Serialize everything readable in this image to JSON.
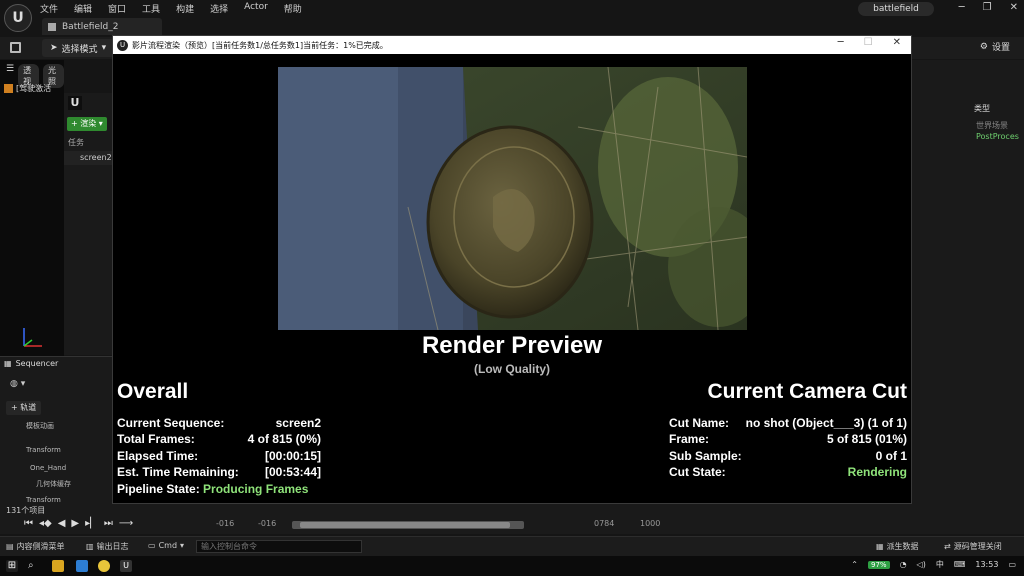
{
  "ue": {
    "menu": [
      "文件",
      "编辑",
      "窗口",
      "工具",
      "构建",
      "选择",
      "Actor",
      "帮助"
    ],
    "level_tab": "Battlefield_2",
    "project_name": "battlefield",
    "mode_label": "选择模式",
    "settings_label": "设置"
  },
  "viewport": {
    "perspective": "透视",
    "lit": "光照",
    "pilot_text": "[驾驶激活"
  },
  "mrq": {
    "add_label": "渲染",
    "tasks_header": "任务",
    "task_name": "screen2"
  },
  "sequencer": {
    "tab_label": "Sequencer",
    "track_label": "轨道",
    "rows": [
      "模板动画",
      "Transform",
      "One_Hand",
      "几何体缓存",
      "Transform"
    ]
  },
  "outliner": {
    "type_header": "类型",
    "rows": [
      "世界场景",
      "PostProces"
    ]
  },
  "dialog": {
    "title": "影片流程渲染（预览）[当前任务数1/总任务数1]当前任务：1%已完成。",
    "preview_title": "Render Preview",
    "preview_sub": "(Low Quality)",
    "overall_title": "Overall",
    "cut_title": "Current Camera Cut",
    "overall": [
      {
        "k": "Current Sequence:",
        "v": "screen2"
      },
      {
        "k": "Total Frames:",
        "v": "4 of 815 (0%)"
      },
      {
        "k": "Elapsed Time:",
        "v": "[00:00:15]"
      },
      {
        "k": "Est. Time Remaining:",
        "v": "[00:53:44]"
      }
    ],
    "pipeline_key": "Pipeline State:",
    "pipeline_val": "Producing Frames",
    "cut": [
      {
        "k": "Cut Name:",
        "v": "no shot (Object___3) (1 of 1)"
      },
      {
        "k": "Frame:",
        "v": "5 of 815 (01%)"
      },
      {
        "k": "Sub Sample:",
        "v": "0 of 1"
      }
    ],
    "cut_state_key": "Cut State:",
    "cut_state_val": "Rendering"
  },
  "timeline": {
    "items_count": "131个项目",
    "start_a": "-016",
    "start_b": "-016",
    "end_a": "0784",
    "end_b": "1000",
    "playhead_fraction": 0.03
  },
  "statusbar": {
    "content_drawer": "内容侧滑菜单",
    "output_log": "输出日志",
    "cmd": "Cmd",
    "console_placeholder": "输入控制台命令",
    "derived_data": "派生数据",
    "source_control": "源码管理关闭"
  },
  "taskbar": {
    "battery": "97%",
    "ime": "中",
    "time": "13:53"
  }
}
